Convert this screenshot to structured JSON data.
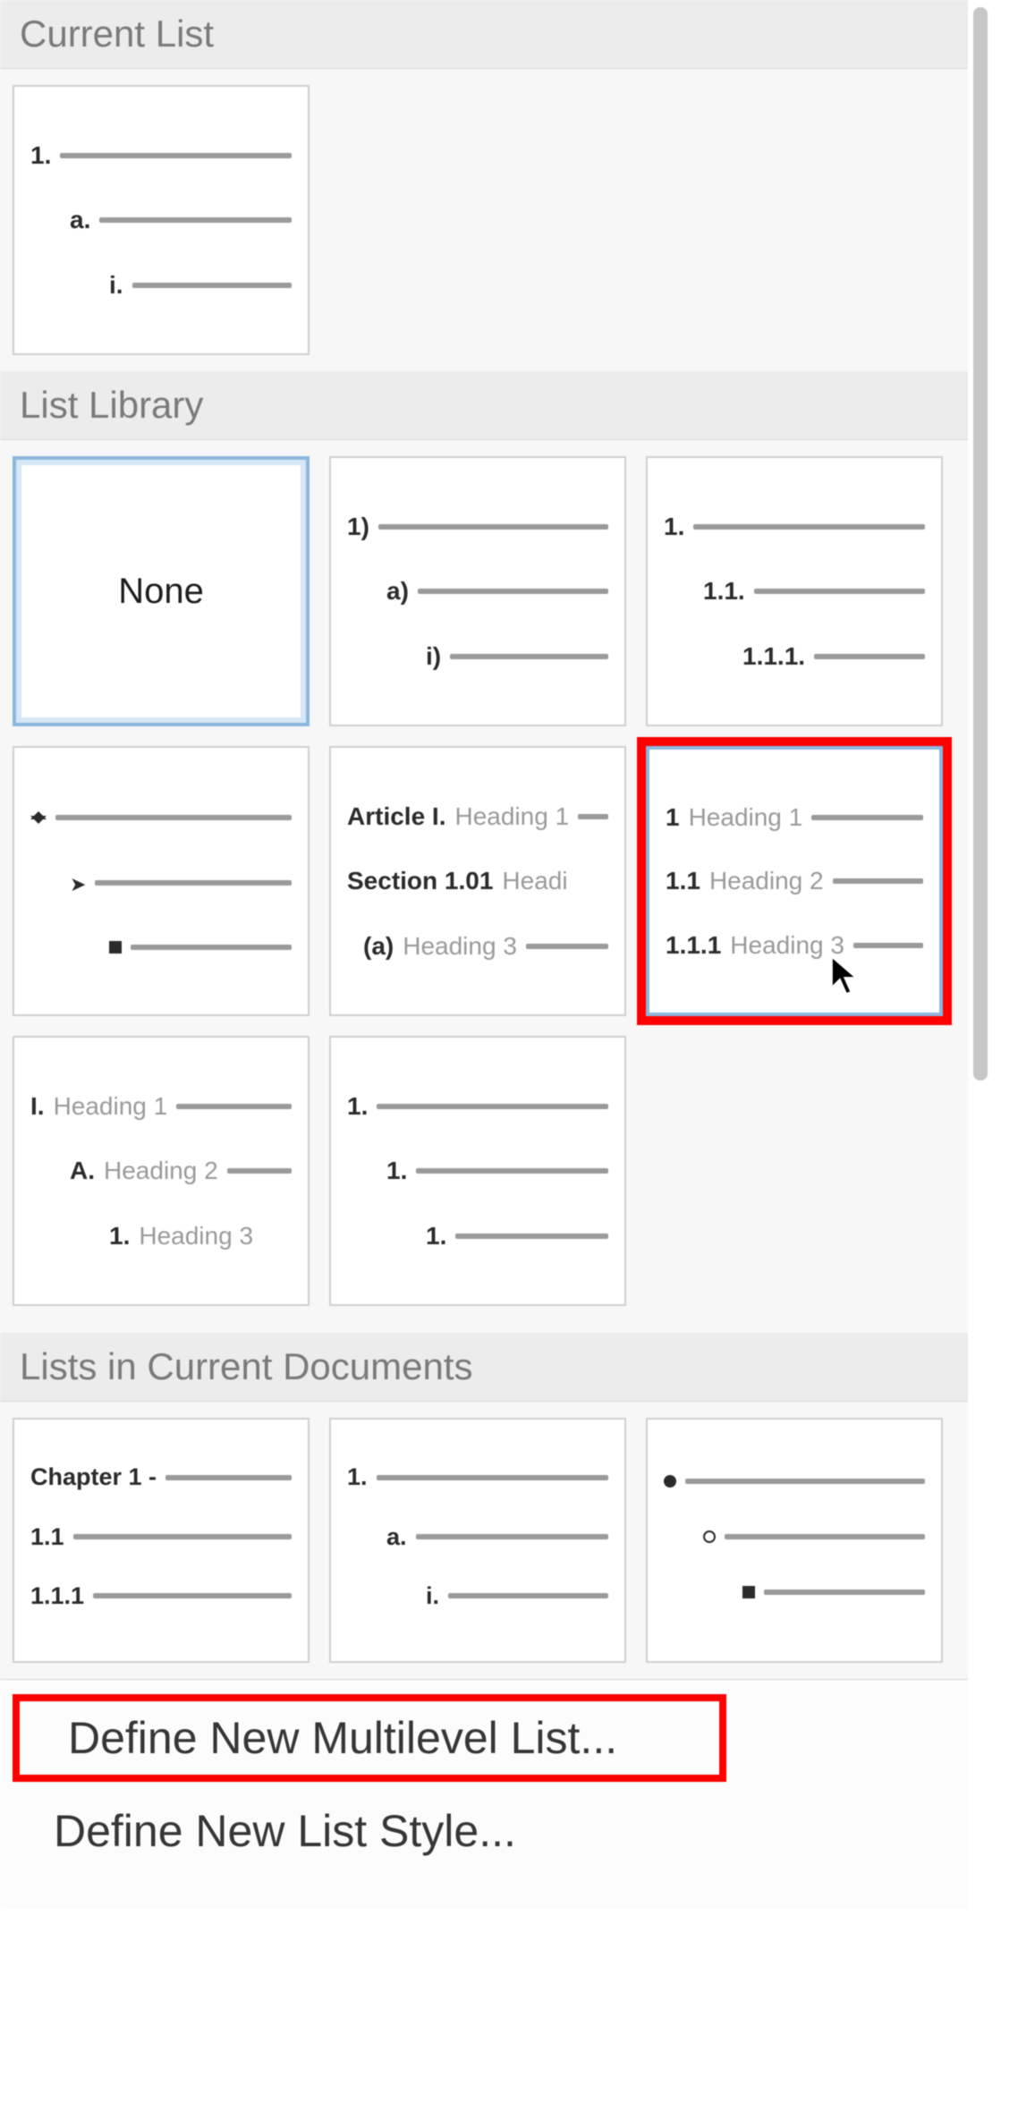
{
  "sections": {
    "current": {
      "title": "Current List"
    },
    "library": {
      "title": "List Library"
    },
    "docs": {
      "title": "Lists in Current Documents"
    }
  },
  "current_tile": {
    "l1": "1.",
    "l2": "a.",
    "l3": "i."
  },
  "library": {
    "none": "None",
    "t1": {
      "l1": "1)",
      "l2": "a)",
      "l3": "i)"
    },
    "t2": {
      "l1": "1.",
      "l2": "1.1.",
      "l3": "1.1.1."
    },
    "t4": {
      "l1n": "Article I.",
      "l1h": "Heading 1",
      "l2n": "Section 1.01",
      "l2h": "Headi",
      "l3n": "(a)",
      "l3h": "Heading 3"
    },
    "t5": {
      "l1n": "1",
      "l1h": "Heading 1",
      "l2n": "1.1",
      "l2h": "Heading 2",
      "l3n": "1.1.1",
      "l3h": "Heading 3"
    },
    "t6": {
      "l1n": "I.",
      "l1h": "Heading 1",
      "l2n": "A.",
      "l2h": "Heading 2",
      "l3n": "1.",
      "l3h": "Heading 3"
    },
    "t7": {
      "l1": "1.",
      "l2": "1.",
      "l3": "1."
    }
  },
  "docs_tiles": {
    "d0": {
      "l1": "Chapter 1 -",
      "l2": "1.1",
      "l3": "1.1.1"
    },
    "d1": {
      "l1": "1.",
      "l2": "a.",
      "l3": "i."
    }
  },
  "menu": {
    "define_multilist": "Define New Multilevel List...",
    "define_style": "Define New List Style..."
  }
}
